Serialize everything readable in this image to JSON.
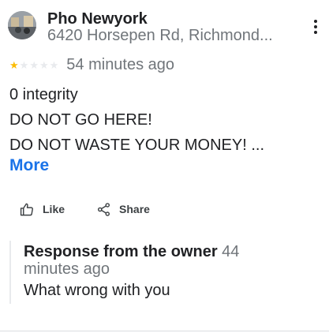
{
  "place": {
    "name": "Pho Newyork",
    "address": "6420 Horsepen Rd, Richmond..."
  },
  "review": {
    "rating": 1,
    "max_rating": 5,
    "time_ago": "54 minutes ago",
    "lines": [
      "0 integrity",
      "DO NOT GO HERE!",
      "DO NOT WASTE YOUR MONEY! ..."
    ],
    "more_label": "More"
  },
  "actions": {
    "like_label": "Like",
    "share_label": "Share"
  },
  "owner_response": {
    "label": "Response from the owner",
    "time_ago": "44 minutes ago",
    "text": "What wrong with you"
  },
  "colors": {
    "star_filled": "#fbbc04",
    "star_empty": "#e8eaed",
    "link": "#1a73e8",
    "secondary_text": "#70757a"
  }
}
